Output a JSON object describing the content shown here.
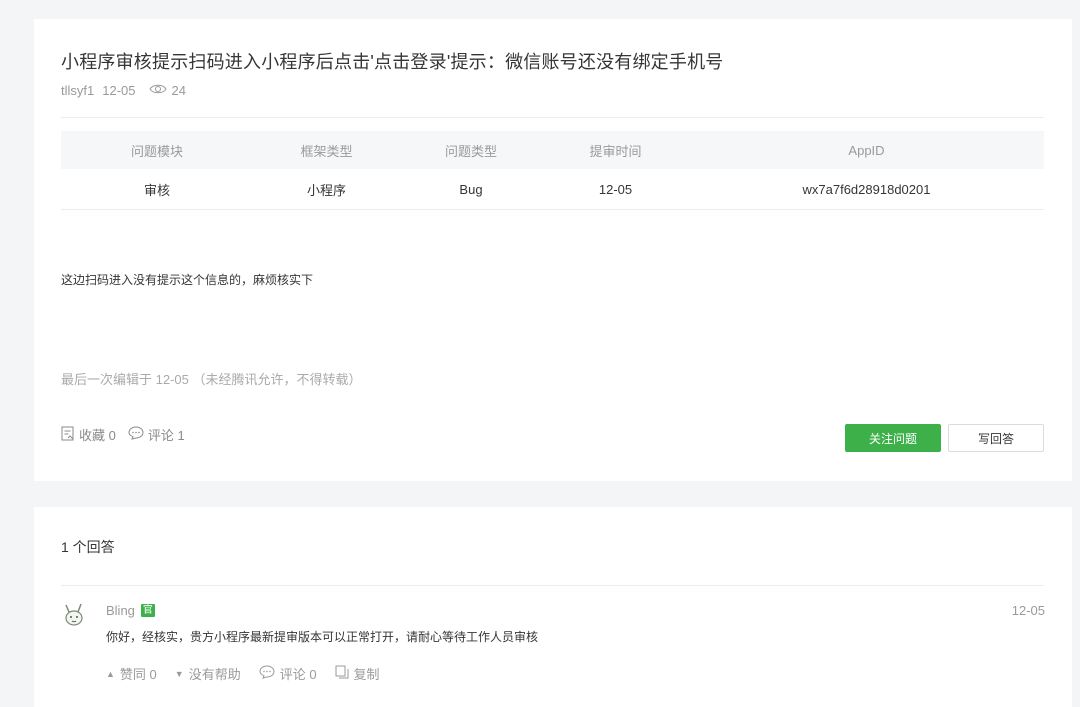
{
  "question": {
    "title": "小程序审核提示扫码进入小程序后点击'点击登录'提示：微信账号还没有绑定手机号",
    "author": "tllsyf1",
    "date": "12-05",
    "views": "24",
    "table": {
      "headers": [
        "问题模块",
        "框架类型",
        "问题类型",
        "提审时间",
        "AppID"
      ],
      "row": [
        "审核",
        "小程序",
        "Bug",
        "12-05",
        "wx7a7f6d28918d0201"
      ]
    },
    "content": "这边扫码进入没有提示这个信息的，麻烦核实下",
    "edit_note": "最后一次编辑于  12-05  （未经腾讯允许，不得转载）",
    "favorite_label": "收藏 0",
    "comment_label": "评论 1",
    "follow_button": "关注问题",
    "answer_button": "写回答"
  },
  "answers": {
    "title": "1 个回答",
    "items": [
      {
        "author": "Bling",
        "badge": "官",
        "date": "12-05",
        "text": "你好，经核实，贵方小程序最新提审版本可以正常打开，请耐心等待工作人员审核",
        "like_label": "赞同 0",
        "unhelpful_label": "没有帮助",
        "comment_label": "评论 0",
        "copy_label": "复制"
      }
    ]
  },
  "colors": {
    "accent": "#3db04a",
    "muted": "#9a9a9a",
    "background": "#f4f5f7"
  }
}
